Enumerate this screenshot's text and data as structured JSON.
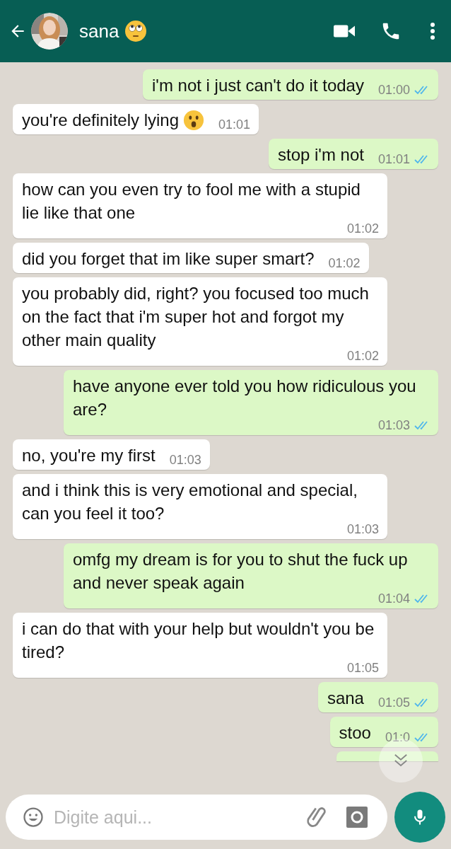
{
  "header": {
    "contact_name": "sana"
  },
  "messages": [
    {
      "kind": "outgoing",
      "text": "i'm not i just can't do it today",
      "time": "01:00",
      "read": true,
      "emoji": false
    },
    {
      "kind": "incoming",
      "text": "you're definitely lying",
      "time": "01:01",
      "emoji": true
    },
    {
      "kind": "outgoing",
      "text": "stop i'm not",
      "time": "01:01",
      "read": true,
      "emoji": false
    },
    {
      "kind": "incoming",
      "text": "how can you even try to fool me with a stupid lie like that one",
      "time": "01:02",
      "emoji": false
    },
    {
      "kind": "incoming",
      "text": "did you forget that im like super smart?",
      "time": "01:02",
      "emoji": false
    },
    {
      "kind": "incoming",
      "text": "you probably did, right? you focused too much on the fact that i'm super hot and forgot my other main quality",
      "time": "01:02",
      "emoji": false
    },
    {
      "kind": "outgoing",
      "text": "have anyone ever told you how ridiculous you are?",
      "time": "01:03",
      "read": true,
      "emoji": false
    },
    {
      "kind": "incoming",
      "text": "no, you're my first",
      "time": "01:03",
      "emoji": false
    },
    {
      "kind": "incoming",
      "text": "and i think this is very emotional and special, can you feel it too?",
      "time": "01:03",
      "emoji": false
    },
    {
      "kind": "outgoing",
      "text": "omfg my dream is for you to shut the fuck up and never speak again",
      "time": "01:04",
      "read": true,
      "emoji": false
    },
    {
      "kind": "incoming",
      "text": "i can do that with your help but wouldn't you be tired?",
      "time": "01:05",
      "emoji": false
    },
    {
      "kind": "outgoing",
      "text": "sana",
      "time": "01:05",
      "read": true,
      "emoji": false
    },
    {
      "kind": "outgoing",
      "text": "stoo",
      "time": "01:0",
      "read": true,
      "emoji": false
    }
  ],
  "composer": {
    "placeholder": "Digite aqui..."
  }
}
